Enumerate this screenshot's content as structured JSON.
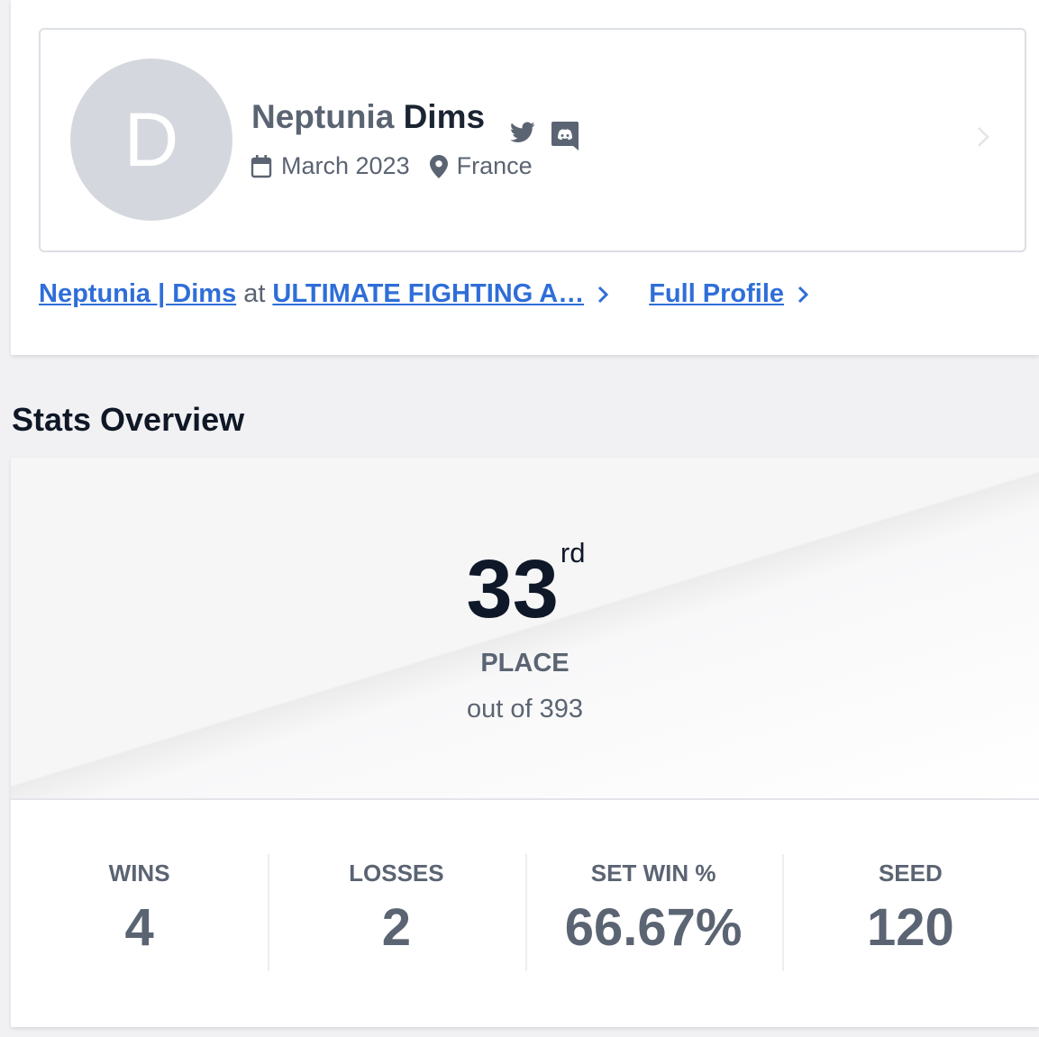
{
  "profile": {
    "avatar_letter": "D",
    "prefix": "Neptunia",
    "gamer_tag": "Dims",
    "joined": "March 2023",
    "location": "France",
    "social_icons": [
      "twitter-icon",
      "discord-icon"
    ]
  },
  "links": {
    "entrant_name": "Neptunia | Dims",
    "at": "at",
    "team": "ULTIMATE FIGHTING A…",
    "full_profile": "Full Profile"
  },
  "stats_overview": {
    "title": "Stats Overview",
    "place_number": "33",
    "place_suffix": "rd",
    "place_label": "PLACE",
    "out_of": "out of 393",
    "stats": [
      {
        "label": "WINS",
        "value": "4"
      },
      {
        "label": "LOSSES",
        "value": "2"
      },
      {
        "label": "SET WIN %",
        "value": "66.67%"
      },
      {
        "label": "SEED",
        "value": "120"
      }
    ]
  },
  "colors": {
    "link": "#2f6ed8",
    "text_muted": "#5b6472",
    "text_dark": "#101826",
    "avatar_bg": "#d4d7dd"
  }
}
